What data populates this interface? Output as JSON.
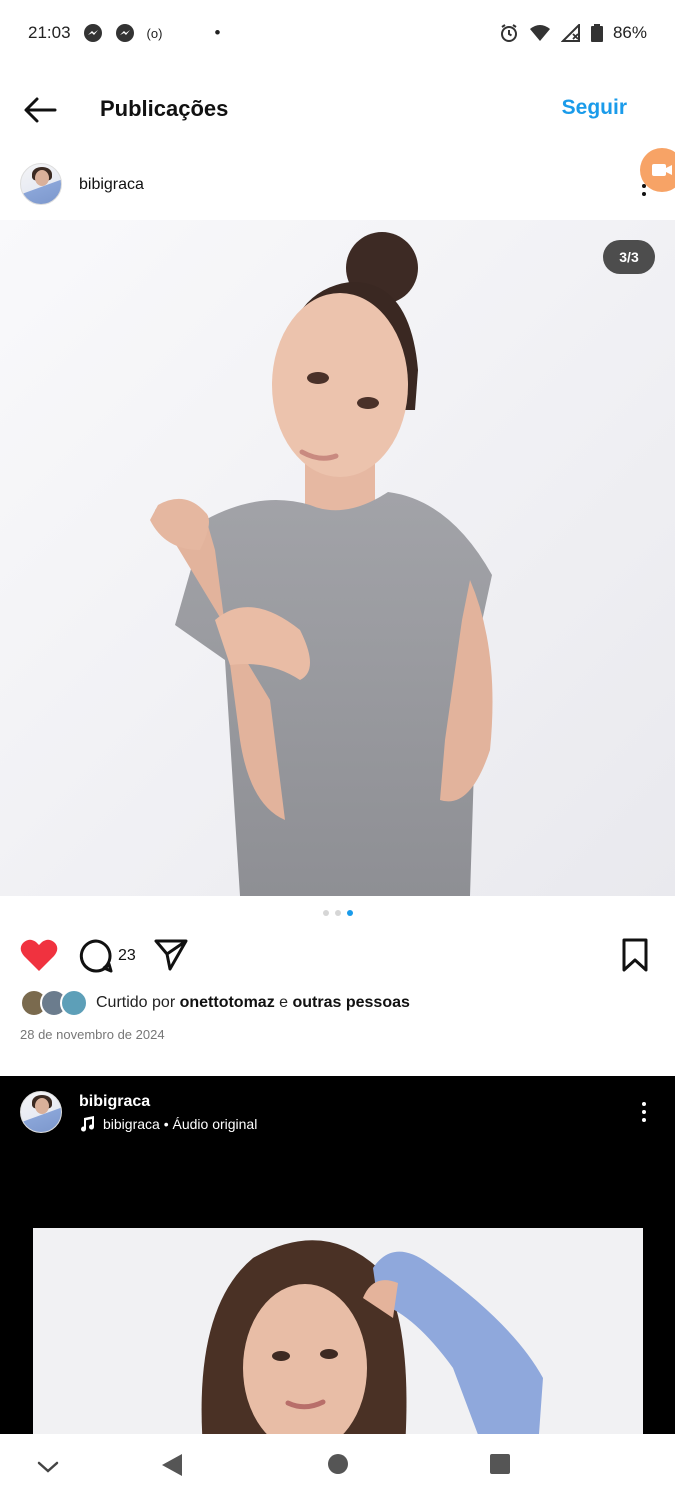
{
  "status_bar": {
    "time": "21:03",
    "cast_icon_text": "(o)",
    "dot": "•",
    "battery": "86%"
  },
  "header": {
    "title": "Publicações",
    "follow_label": "Seguir"
  },
  "post1": {
    "username": "bibigraca",
    "counter": "3/3",
    "comment_count": "23",
    "likes_prefix": "Curtido por ",
    "likes_user": "onettotomaz",
    "likes_mid": " e ",
    "likes_others": "outras pessoas",
    "date": "28 de novembro de 2024"
  },
  "post2": {
    "username": "bibigraca",
    "audio_text": "bibigraca • Áudio original"
  },
  "colors": {
    "accent": "#1a9bea",
    "like_red": "#f0323f"
  }
}
